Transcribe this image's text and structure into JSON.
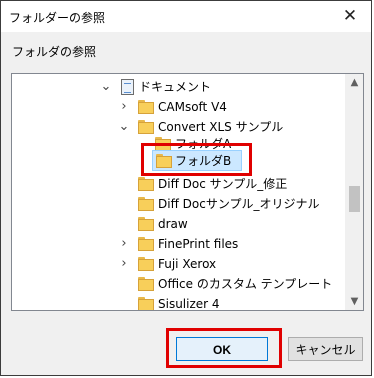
{
  "dialog": {
    "title": "フォルダーの参照",
    "close_label": "✕",
    "prompt": "フォルダの参照"
  },
  "tree": {
    "items": [
      {
        "label": "ドキュメント",
        "icon": "documents-icon",
        "expander": "expanded"
      },
      {
        "label": "CAMsoft V4",
        "icon": "folder-icon",
        "expander": "collapsed"
      },
      {
        "label": "Convert XLS サンプル",
        "icon": "folder-icon",
        "expander": "expanded"
      },
      {
        "label": "フォルダA",
        "icon": "folder-icon",
        "expander": "none"
      },
      {
        "label": "フォルダB",
        "icon": "folder-icon",
        "expander": "none",
        "selected": true
      },
      {
        "label": "Diff Doc サンプル_修正",
        "icon": "folder-icon",
        "expander": "none"
      },
      {
        "label": "Diff Docサンプル_オリジナル",
        "icon": "folder-icon",
        "expander": "none"
      },
      {
        "label": "draw",
        "icon": "folder-icon",
        "expander": "none"
      },
      {
        "label": "FinePrint files",
        "icon": "folder-icon",
        "expander": "collapsed"
      },
      {
        "label": "Fuji Xerox",
        "icon": "folder-icon",
        "expander": "collapsed"
      },
      {
        "label": "Office のカスタム テンプレート",
        "icon": "folder-icon",
        "expander": "none"
      },
      {
        "label": "Sisulizer 4",
        "icon": "folder-icon",
        "expander": "none"
      }
    ],
    "scrollbar": {
      "up": "▲",
      "down": "▼"
    }
  },
  "buttons": {
    "ok": "OK",
    "cancel": "キャンセル"
  },
  "colors": {
    "highlight": "#e00000",
    "selection": "#cce8ff"
  }
}
